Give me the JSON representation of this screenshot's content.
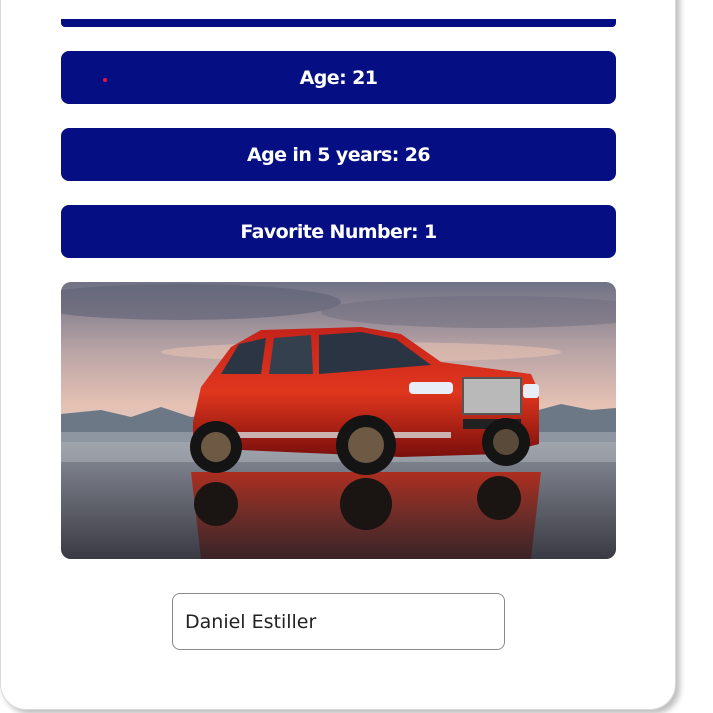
{
  "colors": {
    "accent": "#050e82",
    "text_on_accent": "#ffffff",
    "dot": "#e0183a"
  },
  "info": {
    "age": "Age: 21",
    "age_in_5": "Age in 5 years: 26",
    "favorite_number": "Favorite Number: 1"
  },
  "photo": {
    "subject": "red SUV on reflective water"
  },
  "name_field": {
    "value": "Daniel Estiller"
  }
}
